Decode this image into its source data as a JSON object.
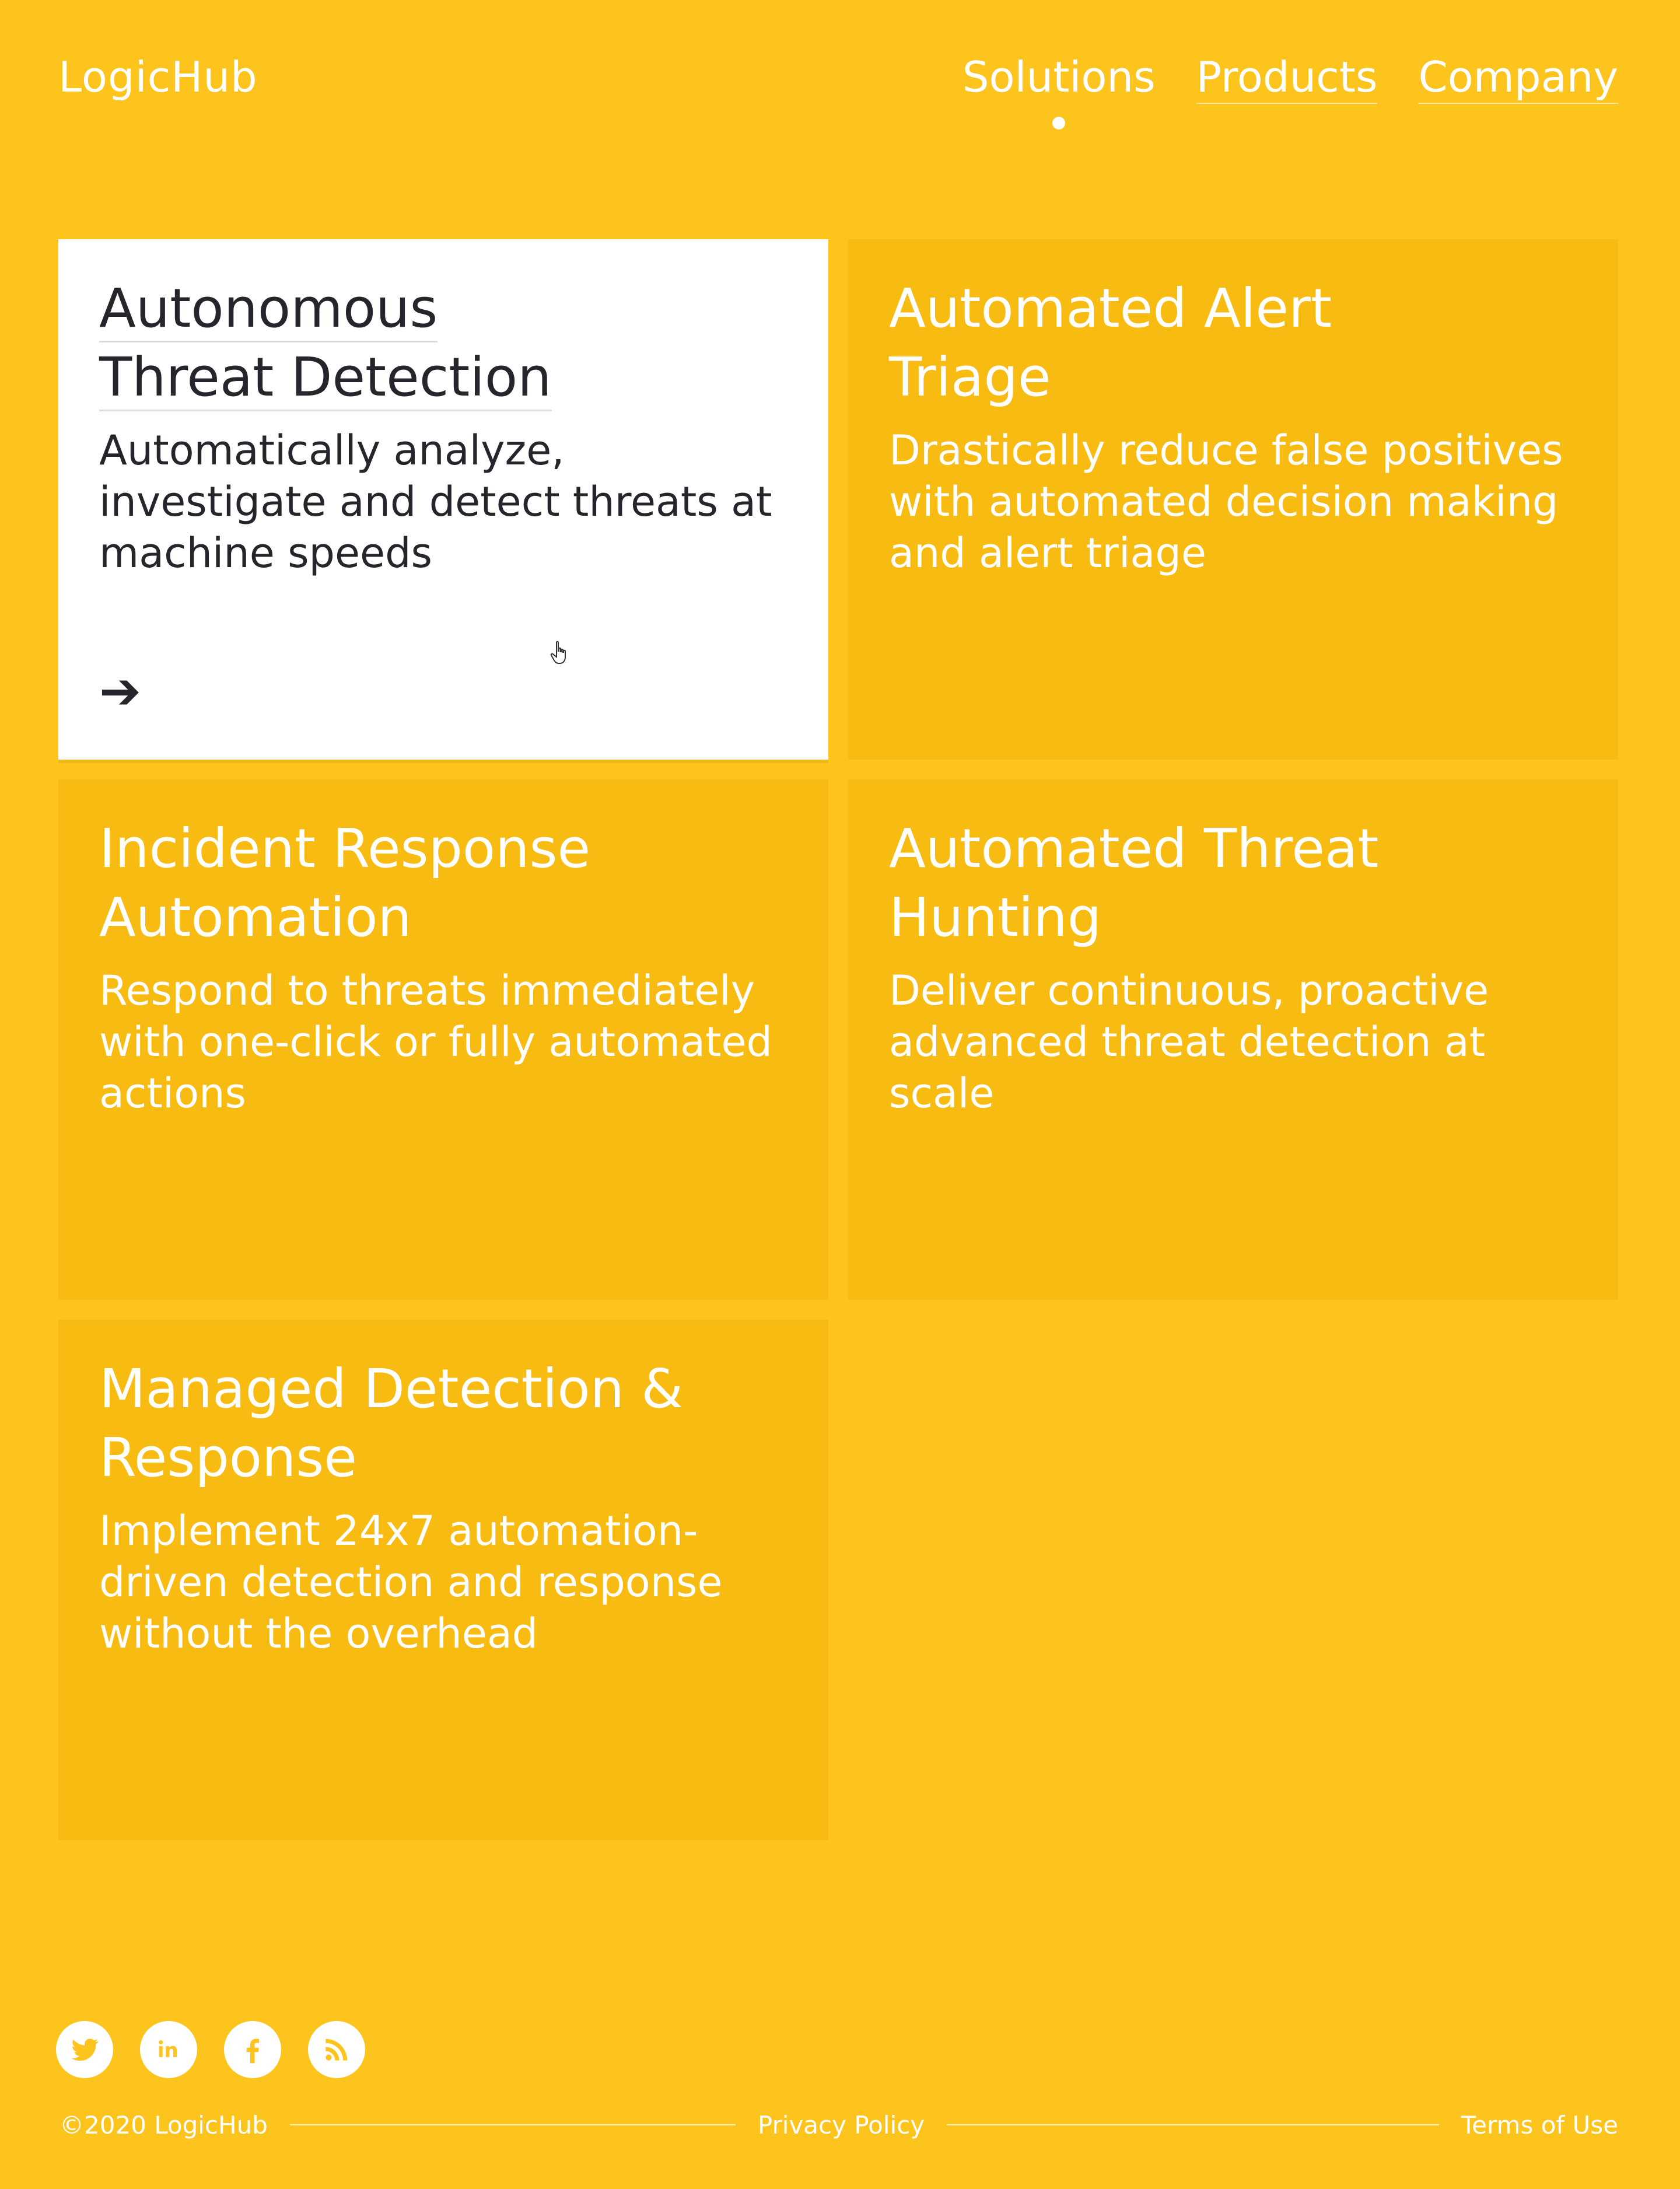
{
  "header": {
    "logo": "LogicHub",
    "nav": [
      {
        "label": "Solutions",
        "active": true
      },
      {
        "label": "Products",
        "active": false
      },
      {
        "label": "Company",
        "active": false
      }
    ]
  },
  "cards": [
    {
      "title_line1": "Autonomous",
      "title_line2": "Threat Detection",
      "description": "Automatically analyze, investigate and detect threats at machine speeds",
      "arrow": "➔",
      "active": true
    },
    {
      "title_line1": "Automated Alert",
      "title_line2": "Triage",
      "description": "Drastically reduce false positives with automated decision making and alert triage",
      "active": false
    },
    {
      "title_line1": "Incident Response",
      "title_line2": "Automation",
      "description": "Respond to threats immediately with one-click or fully automated actions",
      "active": false
    },
    {
      "title_line1": "Automated Threat",
      "title_line2": "Hunting",
      "description": "Deliver continuous, proactive advanced threat detection at scale",
      "active": false
    },
    {
      "title_line1": "Managed Detection &",
      "title_line2": "Response",
      "description": "Implement 24x7 automation-driven detection and response without the overhead",
      "active": false
    }
  ],
  "social": [
    "twitter-icon",
    "linkedin-icon",
    "facebook-icon",
    "rss-icon"
  ],
  "footer": {
    "copyright": "©2020 LogicHub",
    "privacy": "Privacy Policy",
    "terms": "Terms of Use"
  },
  "colors": {
    "background": "#fcc41c",
    "card": "#f8bb12",
    "active_card": "#ffffff",
    "dark_text": "#24262b"
  }
}
